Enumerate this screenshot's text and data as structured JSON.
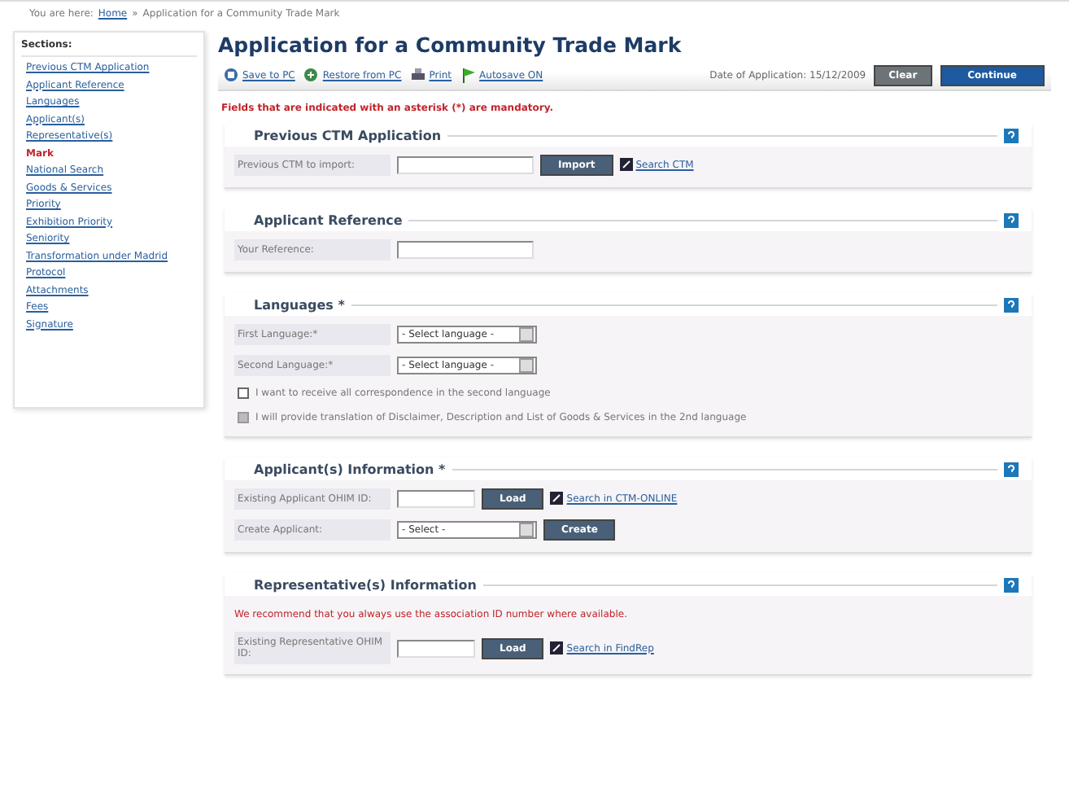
{
  "breadcrumb": {
    "prefix": "You are here:",
    "home": "Home",
    "separator": "»",
    "current": "Application for a Community Trade Mark"
  },
  "sidebar": {
    "title": "Sections:",
    "items": [
      {
        "label": "Previous CTM Application",
        "selected": false
      },
      {
        "label": "Applicant Reference",
        "selected": false
      },
      {
        "label": "Languages",
        "selected": false
      },
      {
        "label": "Applicant(s)",
        "selected": false
      },
      {
        "label": "Representative(s)",
        "selected": false
      },
      {
        "label": "Mark",
        "selected": true
      },
      {
        "label": "National Search",
        "selected": false
      },
      {
        "label": "Goods & Services",
        "selected": false
      },
      {
        "label": "Priority",
        "selected": false
      },
      {
        "label": "Exhibition Priority",
        "selected": false
      },
      {
        "label": "Seniority",
        "selected": false
      },
      {
        "label": "Transformation under Madrid Protocol",
        "selected": false
      },
      {
        "label": "Attachments",
        "selected": false
      },
      {
        "label": "Fees",
        "selected": false
      },
      {
        "label": "Signature",
        "selected": false
      }
    ]
  },
  "title": "Application for a Community Trade Mark",
  "toolbar": {
    "links": [
      {
        "kind": "save",
        "label": "Save to PC"
      },
      {
        "kind": "restore",
        "label": "Restore from PC"
      },
      {
        "kind": "print",
        "label": "Print"
      },
      {
        "kind": "autosave",
        "label": "Autosave ON"
      }
    ],
    "date_label": "Date of Application: 15/12/2009",
    "buttons": [
      {
        "kind": "secondary",
        "label": "Clear"
      },
      {
        "kind": "primary",
        "label": "Continue"
      }
    ]
  },
  "mandatory_note": "Fields that are indicated with an asterisk (*) are mandatory.",
  "sections": [
    {
      "title": "Previous CTM Application",
      "rows": [
        {
          "kind": "field",
          "label": "Previous CTM to import:",
          "button": "Import",
          "link": "Search CTM"
        }
      ]
    },
    {
      "title": "Applicant Reference",
      "rows": [
        {
          "kind": "field",
          "label": "Your Reference:"
        }
      ]
    },
    {
      "title": "Languages *",
      "rows": [
        {
          "kind": "select",
          "label": "First Language:*",
          "value": "- Select language -"
        },
        {
          "kind": "select",
          "label": "Second Language:*",
          "value": "- Select language -"
        },
        {
          "kind": "checkbox",
          "text": "I want to receive all correspondence in the second language",
          "checked": false,
          "disabled": false
        },
        {
          "kind": "checkbox",
          "text": "I will provide translation of Disclaimer, Description and List of Goods & Services in the 2nd language",
          "checked": false,
          "disabled": true
        }
      ]
    },
    {
      "title": "Applicant(s) Information *",
      "rows": [
        {
          "kind": "field",
          "label": "Existing Applicant OHIM ID:",
          "short": true,
          "button": "Load",
          "link": "Search in CTM-ONLINE"
        },
        {
          "kind": "select",
          "label": "Create Applicant:",
          "value": "- Select -",
          "button": "Create"
        }
      ]
    },
    {
      "title": "Representative(s) Information",
      "rows": [
        {
          "kind": "notice",
          "text": "We recommend that you always use the association ID number where available."
        },
        {
          "kind": "field",
          "label": "Existing Representative OHIM ID:",
          "short": true,
          "button": "Load",
          "link": "Search in FindRep"
        }
      ]
    }
  ]
}
